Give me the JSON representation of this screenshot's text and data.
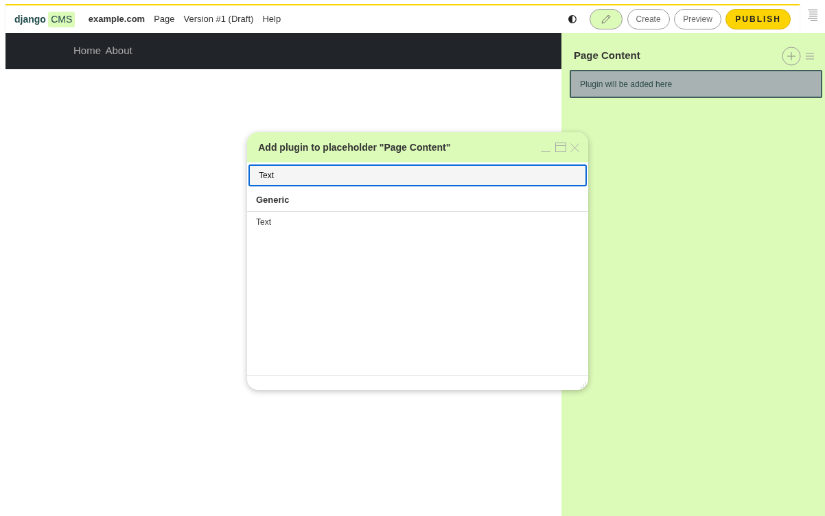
{
  "toolbar": {
    "logo": {
      "text": "django",
      "badge": "CMS"
    },
    "menu": [
      "example.com",
      "Page",
      "Version #1 (Draft)",
      "Help"
    ],
    "edit_mode": {
      "selected": true
    },
    "buttons": [
      {
        "label": "Create",
        "kind": "outline"
      },
      {
        "label": "Preview",
        "kind": "outline"
      },
      {
        "label": "PUBLISH",
        "kind": "primary"
      }
    ]
  },
  "site_nav": [
    "Home",
    "About"
  ],
  "sidebar": {
    "title": "Page Content",
    "drop_target": "Plugin will be added here"
  },
  "modal": {
    "title": "Add plugin to placeholder \"Page Content\"",
    "search": {
      "value": "Text"
    },
    "groups": [
      {
        "title": "Generic",
        "items": [
          "Text"
        ]
      }
    ]
  }
}
